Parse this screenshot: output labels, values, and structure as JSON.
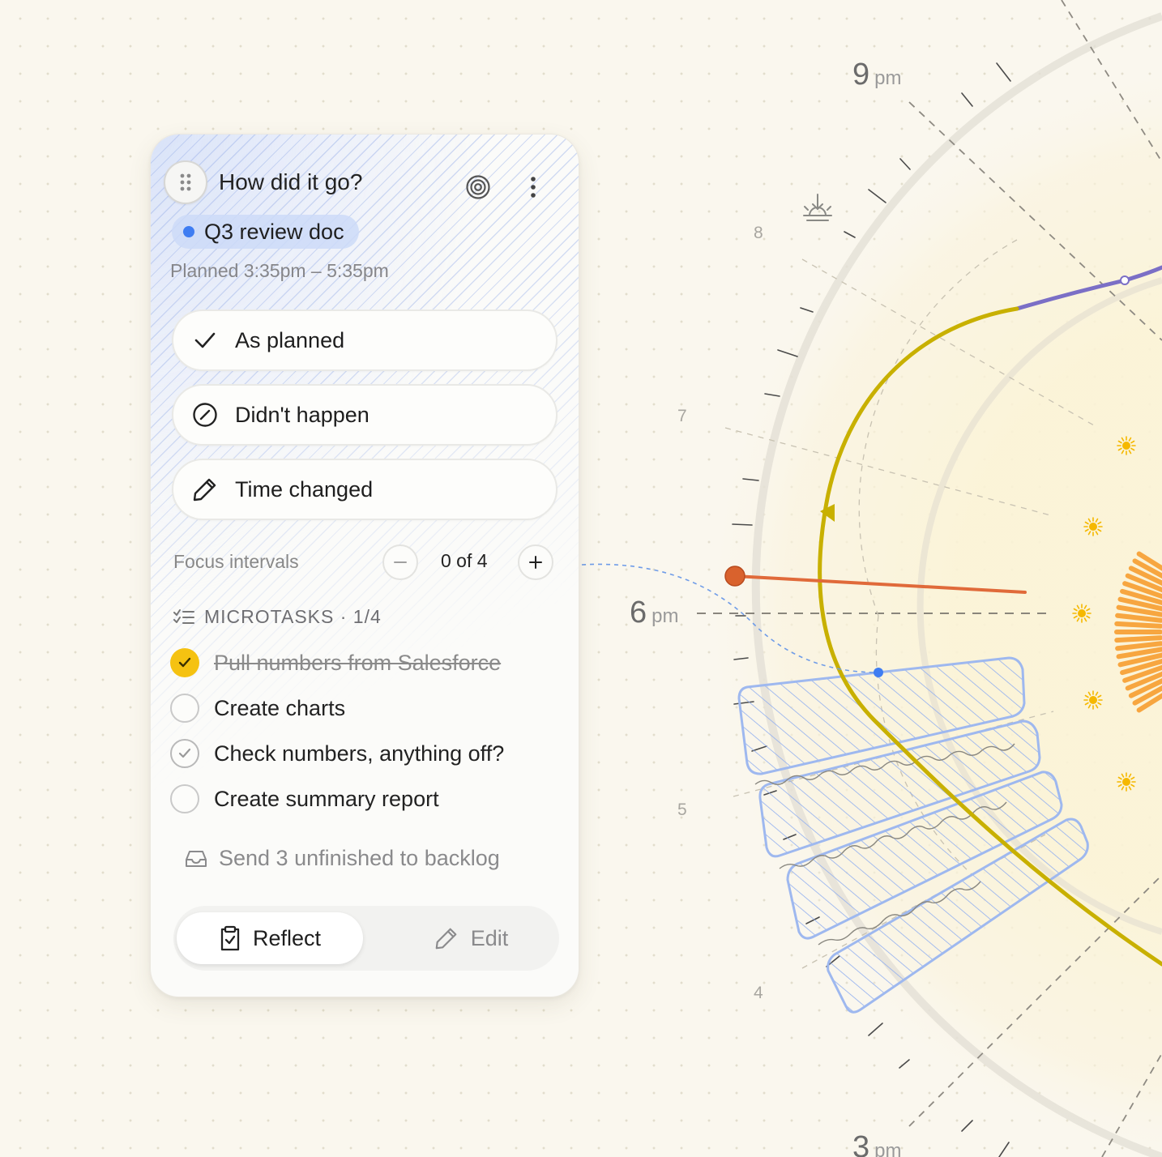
{
  "card": {
    "title": "How did it go?",
    "task_name": "Q3 review doc",
    "task_color": "#3f7df2",
    "planned": "Planned 3:35pm – 5:35pm",
    "options": [
      {
        "label": "As planned",
        "icon": "check-icon"
      },
      {
        "label": "Didn't happen",
        "icon": "slash-circle-icon"
      },
      {
        "label": "Time changed",
        "icon": "pencil-icon"
      }
    ],
    "focus_intervals": {
      "label": "Focus intervals",
      "value": "0 of 4"
    },
    "microtasks": {
      "header": "MICROTASKS · 1/4",
      "items": [
        {
          "label": "Pull numbers from Salesforce",
          "state": "done"
        },
        {
          "label": "Create charts",
          "state": "open"
        },
        {
          "label": "Check numbers, anything off?",
          "state": "pending"
        },
        {
          "label": "Create summary report",
          "state": "open"
        }
      ]
    },
    "backlog_label": "Send 3 unfinished to backlog",
    "reflect_label": "Reflect",
    "edit_label": "Edit"
  },
  "clock": {
    "hours": [
      "8",
      "7",
      "5",
      "4"
    ],
    "major": [
      {
        "num": "9",
        "unit": "pm"
      },
      {
        "num": "6",
        "unit": "pm"
      },
      {
        "num": "3",
        "unit": "pm"
      }
    ],
    "accent_colors": {
      "energy_line": "#c8b000",
      "sleep_line": "#7b6fc6",
      "now_line": "#e06a3a",
      "sun": "#f5b800",
      "task_block": "#9eb8ef"
    }
  }
}
